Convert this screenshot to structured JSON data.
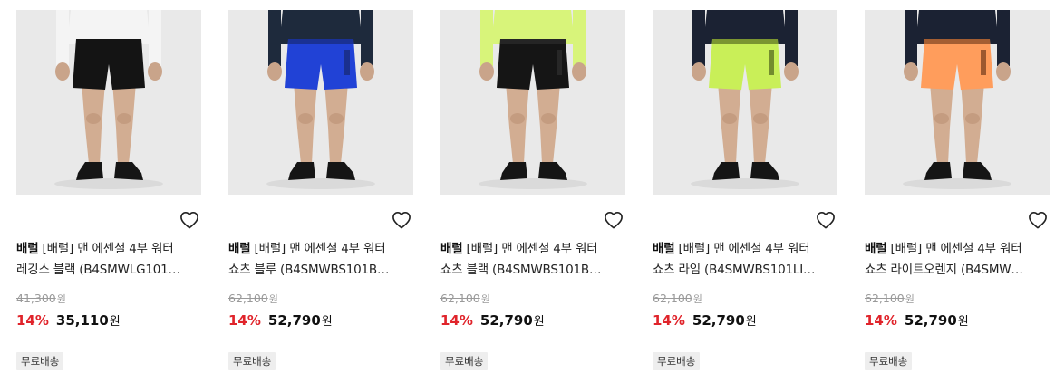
{
  "products": [
    {
      "brand": "배럴",
      "name_line1": "[배럴] 맨 에센셜 4부 워터",
      "name_line2": "레깅스 블랙 (B4SMWLG101…",
      "original_price": "41,300",
      "discount": "14%",
      "sale_price": "35,110",
      "currency": "원",
      "shipping_badge": "무료배송",
      "colors": {
        "top": "#f4f4f4",
        "shorts": "#141414",
        "stripe": "#141414"
      }
    },
    {
      "brand": "배럴",
      "name_line1": "[배럴] 맨 에센셜 4부 워터",
      "name_line2": "쇼츠 블루 (B4SMWBS101B…",
      "original_price": "62,100",
      "discount": "14%",
      "sale_price": "52,790",
      "currency": "원",
      "shipping_badge": "무료배송",
      "colors": {
        "top": "#1e2a3c",
        "shorts": "#2142d6",
        "stripe": "#15255e"
      }
    },
    {
      "brand": "배럴",
      "name_line1": "[배럴] 맨 에센셜 4부 워터",
      "name_line2": "쇼츠 블랙 (B4SMWBS101B…",
      "original_price": "62,100",
      "discount": "14%",
      "sale_price": "52,790",
      "currency": "원",
      "shipping_badge": "무료배송",
      "colors": {
        "top": "#d8f47a",
        "shorts": "#151515",
        "stripe": "#333333"
      }
    },
    {
      "brand": "배럴",
      "name_line1": "[배럴] 맨 에센셜 4부 워터",
      "name_line2": "쇼츠 라임 (B4SMWBS101LI…",
      "original_price": "62,100",
      "discount": "14%",
      "sale_price": "52,790",
      "currency": "원",
      "shipping_badge": "무료배송",
      "colors": {
        "top": "#1b2233",
        "shorts": "#c9ef58",
        "stripe": "#3a4a12"
      }
    },
    {
      "brand": "배럴",
      "name_line1": "[배럴] 맨 에센셜 4부 워터",
      "name_line2": "쇼츠 라이트오렌지 (B4SMW…",
      "original_price": "62,100",
      "discount": "14%",
      "sale_price": "52,790",
      "currency": "원",
      "shipping_badge": "무료배송",
      "colors": {
        "top": "#1b2233",
        "shorts": "#ff9d5c",
        "stripe": "#5a2a10"
      }
    }
  ],
  "icons": {
    "wishlist": "heart-outline-icon"
  },
  "theme": {
    "discount_color": "#e0242b",
    "image_bg": "#e9e9e9",
    "badge_bg": "#eeeeee"
  }
}
